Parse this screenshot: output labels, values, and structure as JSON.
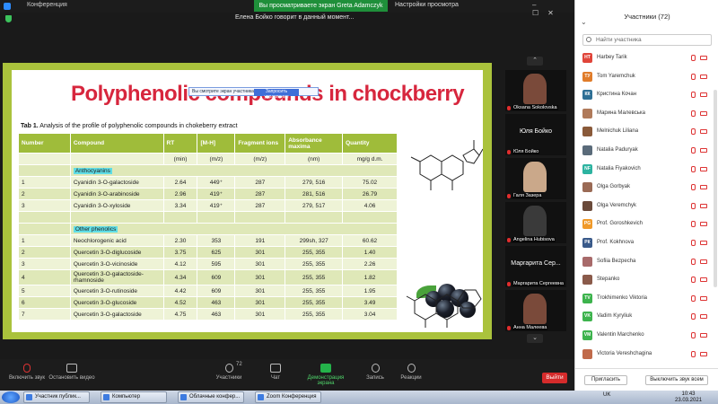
{
  "window": {
    "title": "Конференция",
    "share_banner": "Вы просматриваете экран Greta Adamczyk",
    "view_settings": "Настройки просмотра",
    "speaker": "Елена Бойко говорит в данный момент..."
  },
  "slide": {
    "title": "Polyphenolic compounds in chockberry",
    "annotation_bar": {
      "left": "Вы смотрите экран участника",
      "button": "Запросить управление"
    },
    "caption_bold": "Tab 1.",
    "caption_text": " Analysis of the profile of polyphenolic compounds in chokeberry extract",
    "table": {
      "headers": [
        "Number",
        "Compound",
        "RT",
        "[M-H]",
        "Fragment ions",
        "Absorbance maxima",
        "Quantity"
      ],
      "units": [
        "",
        "",
        "(min)",
        "(m/z)",
        "(m/z)",
        "(nm)",
        "mg/g d.m."
      ],
      "group1": "Anthocyanins",
      "rows1": [
        [
          "1",
          "Cyanidin 3-O-galactoside",
          "2.64",
          "449⁺",
          "287",
          "279, 516",
          "75.02"
        ],
        [
          "2",
          "Cyanidin 3-O-arabinoside",
          "2.96",
          "419⁺",
          "287",
          "281, 516",
          "26.79"
        ],
        [
          "3",
          "Cyanidin 3-O-xyloside",
          "3.34",
          "419⁺",
          "287",
          "279, 517",
          "4.06"
        ]
      ],
      "group2": "Other phenolics",
      "rows2": [
        [
          "1",
          "Neochlorogenic acid",
          "2.30",
          "353",
          "191",
          "299sh, 327",
          "60.62"
        ],
        [
          "2",
          "Quercetin 3-O-diglucoside",
          "3.75",
          "625",
          "301",
          "255, 355",
          "1.40"
        ],
        [
          "3",
          "Quercetin 3-O-vicinoside",
          "4.12",
          "595",
          "301",
          "255, 355",
          "2.26"
        ],
        [
          "4",
          "Quercetin 3-O-galactoside-rhamnoside",
          "4.34",
          "609",
          "301",
          "255, 355",
          "1.82"
        ],
        [
          "5",
          "Quercetin 3-O-rutinoside",
          "4.42",
          "609",
          "301",
          "255, 355",
          "1.95"
        ],
        [
          "6",
          "Quercetin 3-O-glucoside",
          "4.52",
          "463",
          "301",
          "255, 355",
          "3.49"
        ],
        [
          "7",
          "Quercetin 3-O-galactoside",
          "4.75",
          "463",
          "301",
          "255, 355",
          "3.04"
        ]
      ]
    }
  },
  "thumbnails": [
    {
      "name": "Oksana Sokolovska",
      "kind": "video"
    },
    {
      "name": "Юля Бойко",
      "kind": "name",
      "sub": "Юля Бойко"
    },
    {
      "name": "Галя Зазера",
      "kind": "video"
    },
    {
      "name": "Angelina Hubisova",
      "kind": "video"
    },
    {
      "name": "Маргарита Сер...",
      "kind": "name",
      "sub": "Маргарита Сергеевна"
    },
    {
      "name": "Анна Малеева",
      "kind": "video"
    }
  ],
  "toolbar": {
    "items": [
      "Включить звук",
      "Остановить видео",
      "Участники",
      "Чат",
      "Демонстрация экрана",
      "Запись",
      "Реакции"
    ],
    "participants_count": "72",
    "leave": "Выйти"
  },
  "panel": {
    "title": "Участники (72)",
    "search_placeholder": "Найти участника",
    "participants": [
      {
        "initials": "НТ",
        "name": "Harbey Tarik",
        "color": "#e0453a"
      },
      {
        "initials": "ТУ",
        "name": "Tom Yaremchuk",
        "color": "#e07c2a"
      },
      {
        "initials": "КК",
        "name": "Кристина Кочан",
        "color": "#2e6f95"
      },
      {
        "initials": "",
        "name": "Марина Малевська",
        "color": "#b07a5a"
      },
      {
        "initials": "",
        "name": "Melnichuk Liliana",
        "color": "#8a5a3a"
      },
      {
        "initials": "",
        "name": "Natalia Paduryak",
        "color": "#5a6b7a"
      },
      {
        "initials": "NF",
        "name": "Natalia Fiyakovich",
        "color": "#2db3a0"
      },
      {
        "initials": "",
        "name": "Olga Gorbyak",
        "color": "#9a6a55"
      },
      {
        "initials": "",
        "name": "Olga Veremchyk",
        "color": "#6a4a3a"
      },
      {
        "initials": "PG",
        "name": "Prof. Goroshkevich",
        "color": "#f09a2a"
      },
      {
        "initials": "РК",
        "name": "Prof. Kokhnova",
        "color": "#3a5a8a"
      },
      {
        "initials": "",
        "name": "Sofiia Bezpecha",
        "color": "#a86a6a"
      },
      {
        "initials": "",
        "name": "Stepanko",
        "color": "#8a5a4a"
      },
      {
        "initials": "TV",
        "name": "Trokhimenko Viktoria",
        "color": "#3db34d"
      },
      {
        "initials": "VK",
        "name": "Vadim Kyryliuk",
        "color": "#3db34d"
      },
      {
        "initials": "VM",
        "name": "Valentin Marchenko",
        "color": "#3db34d"
      },
      {
        "initials": "",
        "name": "Victoria Vereshchagina",
        "color": "#c06a4a"
      }
    ],
    "invite": "Пригласить",
    "mute_all": "Выключить звук всем"
  },
  "taskbar": {
    "tasks": [
      "Участник публик...",
      "Компьютер",
      "Облачные конфер...",
      "Zoom Конференция"
    ],
    "lang": "UK",
    "time": "10:43",
    "date": "23.03.2021"
  }
}
